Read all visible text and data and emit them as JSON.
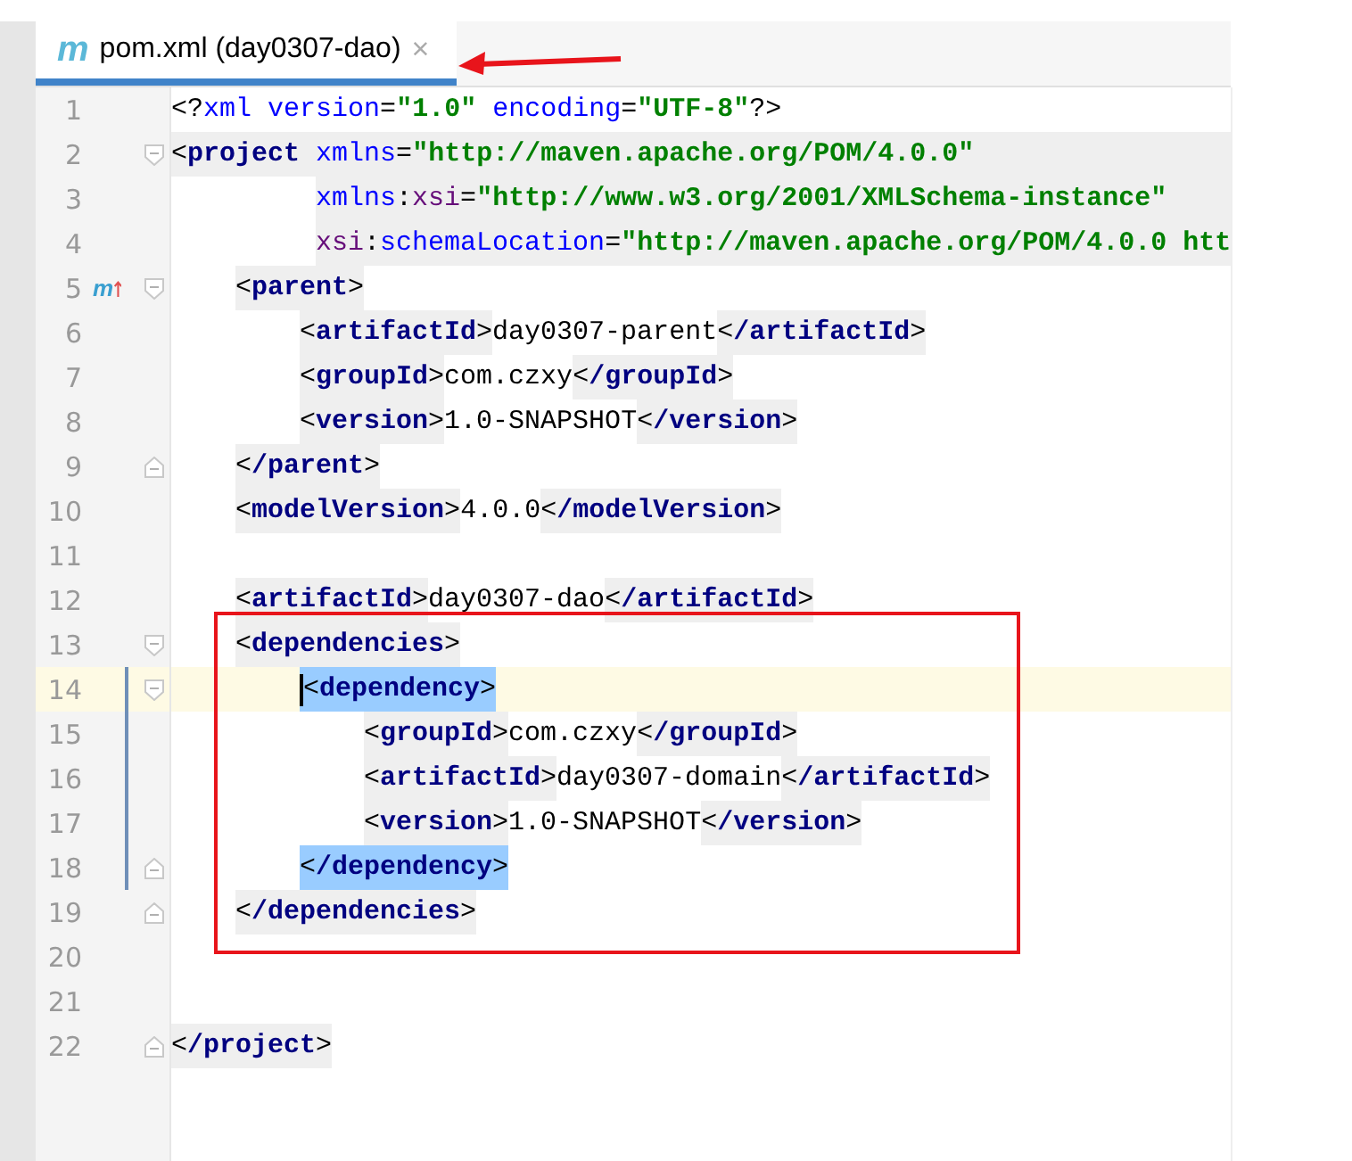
{
  "tab": {
    "icon_letter": "m",
    "label": "pom.xml (day0307-dao)",
    "close": "×",
    "selected": true
  },
  "lines": [
    {
      "number": "1",
      "segments": [
        {
          "kind": "plain",
          "tokens": [
            {
              "kind": "punct",
              "text": "<?"
            },
            {
              "kind": "pi",
              "text": "xml"
            },
            {
              "kind": "attr",
              "text": "version",
              "spaced": true
            },
            {
              "kind": "punct",
              "text": "="
            },
            {
              "kind": "value",
              "text": "\"1.0\""
            },
            {
              "kind": "attr",
              "text": "encoding",
              "spaced": true
            },
            {
              "kind": "punct",
              "text": "="
            },
            {
              "kind": "value",
              "text": "\"UTF-8\""
            },
            {
              "kind": "punct",
              "text": "?>"
            }
          ]
        }
      ]
    },
    {
      "number": "2",
      "shaded": true,
      "fold": {
        "kind": "start"
      },
      "segments": [
        {
          "kind": "plain",
          "tokens": [
            {
              "kind": "punct",
              "text": "<"
            },
            {
              "kind": "tag",
              "text": "project"
            },
            {
              "kind": "attr",
              "text": "xmlns",
              "spaced": true
            },
            {
              "kind": "punct",
              "text": "="
            },
            {
              "kind": "value",
              "text": "\"http://maven.apache.org/POM/4.0.0\""
            }
          ]
        }
      ],
      "children": [
        {
          "number": "3",
          "kind": "continuation",
          "shaded": true,
          "segments": [
            {
              "kind": "plain",
              "tokens": [
                {
                  "kind": "attr",
                  "text": "xmlns"
                },
                {
                  "kind": "punct",
                  "text": ":"
                },
                {
                  "kind": "ns",
                  "text": "xsi"
                },
                {
                  "kind": "punct",
                  "text": "="
                },
                {
                  "kind": "value",
                  "text": "\"http://www.w3.org/2001/XMLSchema-instance\""
                }
              ]
            }
          ]
        },
        {
          "number": "4",
          "kind": "continuation",
          "shaded": true,
          "segments": [
            {
              "kind": "plain",
              "tokens": [
                {
                  "kind": "ns",
                  "text": "xsi"
                },
                {
                  "kind": "punct",
                  "text": ":"
                },
                {
                  "kind": "attr",
                  "text": "schemaLocation"
                },
                {
                  "kind": "punct",
                  "text": "="
                },
                {
                  "kind": "value",
                  "text": "\"http://maven.apache.org/POM/4.0.0 htt"
                }
              ]
            }
          ]
        },
        {
          "number": "5",
          "gutter_mark": "m",
          "fold": {
            "kind": "start"
          },
          "segments": [
            {
              "kind": "tag",
              "tokens": [
                {
                  "kind": "punct",
                  "text": "<"
                },
                {
                  "kind": "tag",
                  "text": "parent"
                },
                {
                  "kind": "punct",
                  "text": ">"
                }
              ]
            }
          ],
          "children": [
            {
              "number": "6",
              "segments": [
                {
                  "kind": "tag",
                  "tokens": [
                    {
                      "kind": "punct",
                      "text": "<"
                    },
                    {
                      "kind": "tag",
                      "text": "artifactId"
                    },
                    {
                      "kind": "punct",
                      "text": ">"
                    }
                  ]
                },
                {
                  "kind": "plain",
                  "tokens": [
                    {
                      "kind": "text",
                      "text": "day0307-parent"
                    }
                  ]
                },
                {
                  "kind": "tag",
                  "tokens": [
                    {
                      "kind": "punct",
                      "text": "<"
                    },
                    {
                      "kind": "tag",
                      "text": "/artifactId"
                    },
                    {
                      "kind": "punct",
                      "text": ">"
                    }
                  ]
                }
              ]
            },
            {
              "number": "7",
              "segments": [
                {
                  "kind": "tag",
                  "tokens": [
                    {
                      "kind": "punct",
                      "text": "<"
                    },
                    {
                      "kind": "tag",
                      "text": "groupId"
                    },
                    {
                      "kind": "punct",
                      "text": ">"
                    }
                  ]
                },
                {
                  "kind": "plain",
                  "tokens": [
                    {
                      "kind": "text",
                      "text": "com.czxy"
                    }
                  ]
                },
                {
                  "kind": "tag",
                  "tokens": [
                    {
                      "kind": "punct",
                      "text": "<"
                    },
                    {
                      "kind": "tag",
                      "text": "/groupId"
                    },
                    {
                      "kind": "punct",
                      "text": ">"
                    }
                  ]
                }
              ]
            },
            {
              "number": "8",
              "segments": [
                {
                  "kind": "tag",
                  "tokens": [
                    {
                      "kind": "punct",
                      "text": "<"
                    },
                    {
                      "kind": "tag",
                      "text": "version"
                    },
                    {
                      "kind": "punct",
                      "text": ">"
                    }
                  ]
                },
                {
                  "kind": "plain",
                  "tokens": [
                    {
                      "kind": "text",
                      "text": "1.0-SNAPSHOT"
                    }
                  ]
                },
                {
                  "kind": "tag",
                  "tokens": [
                    {
                      "kind": "punct",
                      "text": "<"
                    },
                    {
                      "kind": "tag",
                      "text": "/version"
                    },
                    {
                      "kind": "punct",
                      "text": ">"
                    }
                  ]
                }
              ]
            }
          ]
        },
        {
          "number": "9",
          "fold": {
            "kind": "end"
          },
          "segments": [
            {
              "kind": "tag",
              "tokens": [
                {
                  "kind": "punct",
                  "text": "<"
                },
                {
                  "kind": "tag",
                  "text": "/parent"
                },
                {
                  "kind": "punct",
                  "text": ">"
                }
              ]
            }
          ]
        },
        {
          "number": "10",
          "segments": [
            {
              "kind": "tag",
              "tokens": [
                {
                  "kind": "punct",
                  "text": "<"
                },
                {
                  "kind": "tag",
                  "text": "modelVersion"
                },
                {
                  "kind": "punct",
                  "text": ">"
                }
              ]
            },
            {
              "kind": "plain",
              "tokens": [
                {
                  "kind": "text",
                  "text": "4.0.0"
                }
              ]
            },
            {
              "kind": "tag",
              "tokens": [
                {
                  "kind": "punct",
                  "text": "<"
                },
                {
                  "kind": "tag",
                  "text": "/modelVersion"
                },
                {
                  "kind": "punct",
                  "text": ">"
                }
              ]
            }
          ]
        },
        {
          "number": "11"
        },
        {
          "number": "12",
          "segments": [
            {
              "kind": "tag",
              "tokens": [
                {
                  "kind": "punct",
                  "text": "<"
                },
                {
                  "kind": "tag",
                  "text": "artifactId"
                },
                {
                  "kind": "punct",
                  "text": ">"
                }
              ]
            },
            {
              "kind": "plain",
              "tokens": [
                {
                  "kind": "text",
                  "text": "day0307-dao"
                }
              ]
            },
            {
              "kind": "tag",
              "tokens": [
                {
                  "kind": "punct",
                  "text": "<"
                },
                {
                  "kind": "tag",
                  "text": "/artifactId"
                },
                {
                  "kind": "punct",
                  "text": ">"
                }
              ]
            }
          ]
        },
        {
          "number": "13",
          "fold": {
            "kind": "start"
          },
          "segments": [
            {
              "kind": "tag",
              "tokens": [
                {
                  "kind": "punct",
                  "text": "<"
                },
                {
                  "kind": "tag",
                  "text": "dependencies"
                },
                {
                  "kind": "punct",
                  "text": ">"
                }
              ]
            }
          ],
          "children": [
            {
              "number": "14",
              "current": true,
              "changed": true,
              "fold": {
                "kind": "start"
              },
              "segments": [
                {
                  "kind": "match",
                  "tokens": [
                    {
                      "kind": "punct",
                      "text": "<"
                    },
                    {
                      "kind": "tag",
                      "text": "dependency"
                    },
                    {
                      "kind": "punct",
                      "text": ">"
                    }
                  ]
                }
              ],
              "children": [
                {
                  "number": "15",
                  "changed": true,
                  "segments": [
                    {
                      "kind": "tag",
                      "tokens": [
                        {
                          "kind": "punct",
                          "text": "<"
                        },
                        {
                          "kind": "tag",
                          "text": "groupId"
                        },
                        {
                          "kind": "punct",
                          "text": ">"
                        }
                      ]
                    },
                    {
                      "kind": "plain",
                      "tokens": [
                        {
                          "kind": "text",
                          "text": "com.czxy"
                        }
                      ]
                    },
                    {
                      "kind": "tag",
                      "tokens": [
                        {
                          "kind": "punct",
                          "text": "<"
                        },
                        {
                          "kind": "tag",
                          "text": "/groupId"
                        },
                        {
                          "kind": "punct",
                          "text": ">"
                        }
                      ]
                    }
                  ]
                },
                {
                  "number": "16",
                  "changed": true,
                  "segments": [
                    {
                      "kind": "tag",
                      "tokens": [
                        {
                          "kind": "punct",
                          "text": "<"
                        },
                        {
                          "kind": "tag",
                          "text": "artifactId"
                        },
                        {
                          "kind": "punct",
                          "text": ">"
                        }
                      ]
                    },
                    {
                      "kind": "plain",
                      "tokens": [
                        {
                          "kind": "text",
                          "text": "day0307-domain"
                        }
                      ]
                    },
                    {
                      "kind": "tag",
                      "tokens": [
                        {
                          "kind": "punct",
                          "text": "<"
                        },
                        {
                          "kind": "tag",
                          "text": "/artifactId"
                        },
                        {
                          "kind": "punct",
                          "text": ">"
                        }
                      ]
                    }
                  ]
                },
                {
                  "number": "17",
                  "changed": true,
                  "segments": [
                    {
                      "kind": "tag",
                      "tokens": [
                        {
                          "kind": "punct",
                          "text": "<"
                        },
                        {
                          "kind": "tag",
                          "text": "version"
                        },
                        {
                          "kind": "punct",
                          "text": ">"
                        }
                      ]
                    },
                    {
                      "kind": "plain",
                      "tokens": [
                        {
                          "kind": "text",
                          "text": "1.0-SNAPSHOT"
                        }
                      ]
                    },
                    {
                      "kind": "tag",
                      "tokens": [
                        {
                          "kind": "punct",
                          "text": "<"
                        },
                        {
                          "kind": "tag",
                          "text": "/version"
                        },
                        {
                          "kind": "punct",
                          "text": ">"
                        }
                      ]
                    }
                  ]
                }
              ]
            },
            {
              "number": "18",
              "changed": true,
              "fold": {
                "kind": "end"
              },
              "segments": [
                {
                  "kind": "match",
                  "tokens": [
                    {
                      "kind": "punct",
                      "text": "<"
                    },
                    {
                      "kind": "tag",
                      "text": "/dependency"
                    },
                    {
                      "kind": "punct",
                      "text": ">"
                    }
                  ]
                }
              ]
            }
          ]
        },
        {
          "number": "19",
          "fold": {
            "kind": "end"
          },
          "segments": [
            {
              "kind": "tag",
              "tokens": [
                {
                  "kind": "punct",
                  "text": "<"
                },
                {
                  "kind": "tag",
                  "text": "/dependencies"
                },
                {
                  "kind": "punct",
                  "text": ">"
                }
              ]
            }
          ]
        }
      ]
    },
    {
      "number": "20"
    },
    {
      "number": "21"
    },
    {
      "number": "22",
      "fold": {
        "kind": "end"
      },
      "segments": [
        {
          "kind": "tag",
          "tokens": [
            {
              "kind": "punct",
              "text": "<"
            },
            {
              "kind": "tag",
              "text": "/project"
            },
            {
              "kind": "punct",
              "text": ">"
            }
          ]
        }
      ]
    }
  ]
}
